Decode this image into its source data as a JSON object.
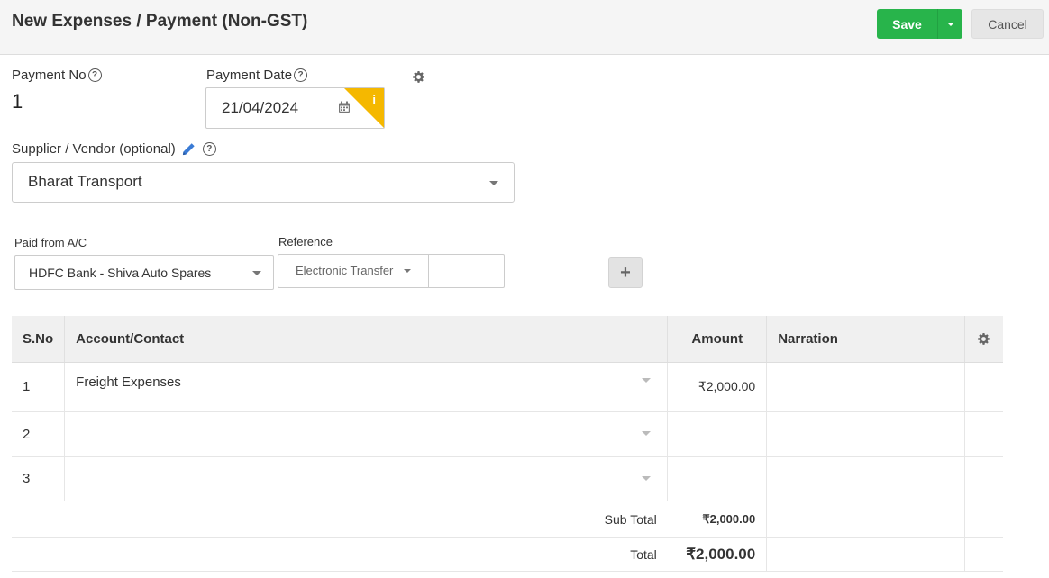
{
  "header": {
    "title": "New Expenses / Payment (Non-GST)",
    "save_label": "Save",
    "cancel_label": "Cancel"
  },
  "form": {
    "payment_no_label": "Payment No",
    "payment_no_value": "1",
    "payment_date_label": "Payment Date",
    "payment_date_value": "21/04/2024",
    "supplier_label": "Supplier / Vendor (optional)",
    "supplier_value": "Bharat Transport",
    "paid_from_label": "Paid from A/C",
    "paid_from_value": "HDFC Bank - Shiva Auto Spares",
    "reference_label": "Reference",
    "reference_type": "Electronic Transfer",
    "reference_value": "",
    "info_icon": "i",
    "help_icon": "?",
    "plus_icon": "+"
  },
  "table": {
    "headers": {
      "sno": "S.No",
      "account": "Account/Contact",
      "amount": "Amount",
      "narration": "Narration"
    },
    "rows": [
      {
        "sno": "1",
        "account": "Freight Expenses",
        "amount": "₹2,000.00",
        "narration": ""
      },
      {
        "sno": "2",
        "account": "",
        "amount": "",
        "narration": ""
      },
      {
        "sno": "3",
        "account": "",
        "amount": "",
        "narration": ""
      }
    ],
    "subtotal_label": "Sub Total",
    "subtotal_value": "₹2,000.00",
    "total_label": "Total",
    "total_value": "₹2,000.00"
  },
  "colors": {
    "save": "#28b44b",
    "info_flag": "#f5b800",
    "pencil": "#3a7bd5"
  }
}
